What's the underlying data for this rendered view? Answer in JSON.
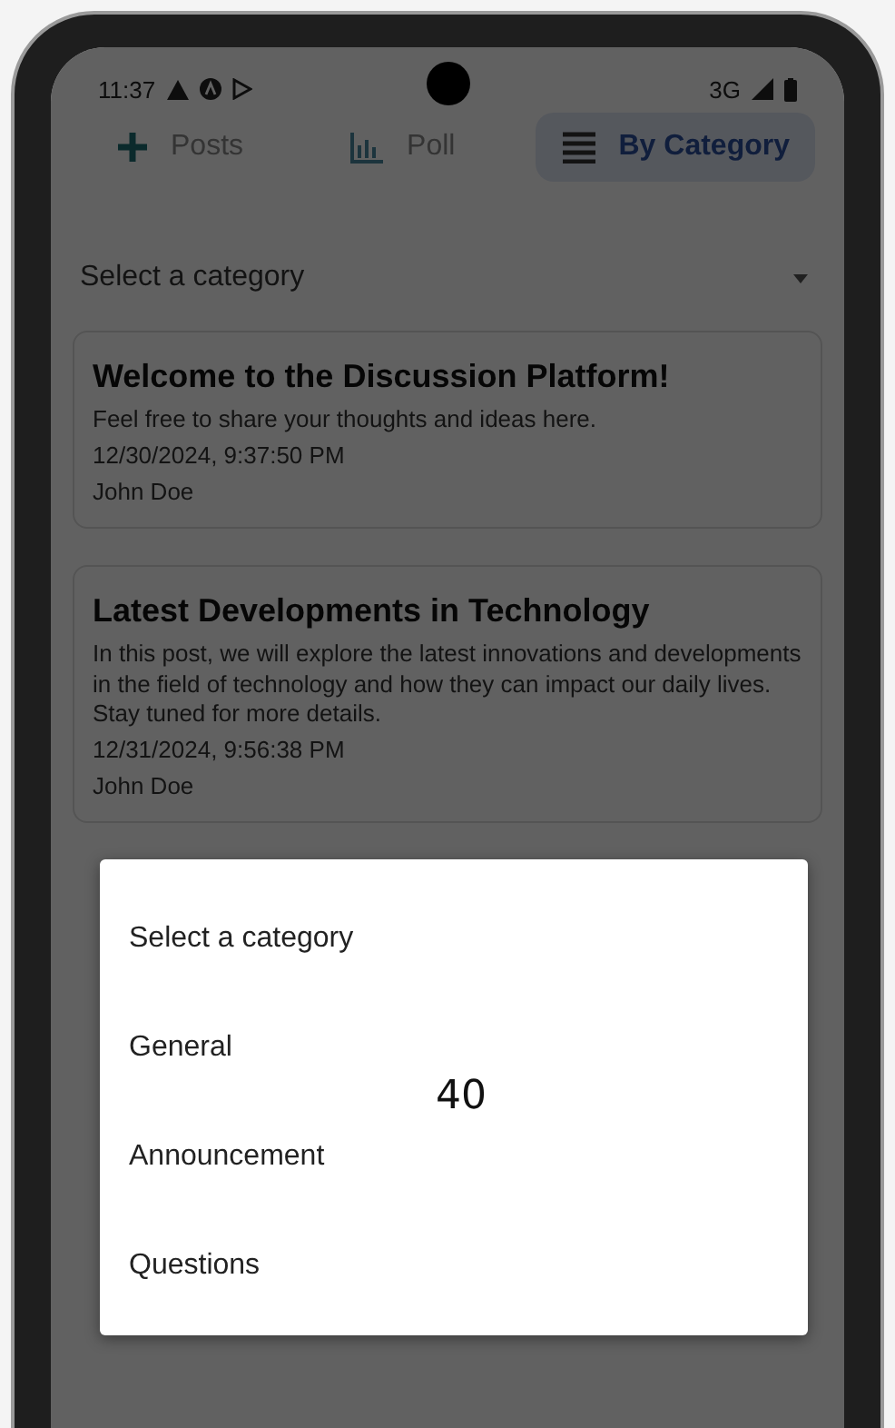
{
  "status_bar": {
    "time": "11:37",
    "network": "3G"
  },
  "tabs": [
    {
      "label": "Posts",
      "kind": "create",
      "selected": false
    },
    {
      "label": "Poll",
      "kind": "poll",
      "selected": false
    },
    {
      "label": "By Category",
      "kind": "category",
      "selected": true
    }
  ],
  "category_select": {
    "placeholder": "Select a category"
  },
  "posts": [
    {
      "title": "Welcome to the Discussion Platform!",
      "body": "Feel free to share your thoughts and ideas here.",
      "date": "12/30/2024, 9:37:50 PM",
      "author": "John Doe"
    },
    {
      "title": "Latest Developments in Technology",
      "body": "In this post, we will explore the latest innovations and developments in the field of technology and how they can impact our daily lives. Stay tuned for more details.",
      "date": "12/31/2024, 9:56:38 PM",
      "author": "John Doe"
    }
  ],
  "dropdown_menu": {
    "options": [
      "Select a category",
      "General",
      "Announcement",
      "Questions"
    ],
    "overlay_number": "40"
  }
}
